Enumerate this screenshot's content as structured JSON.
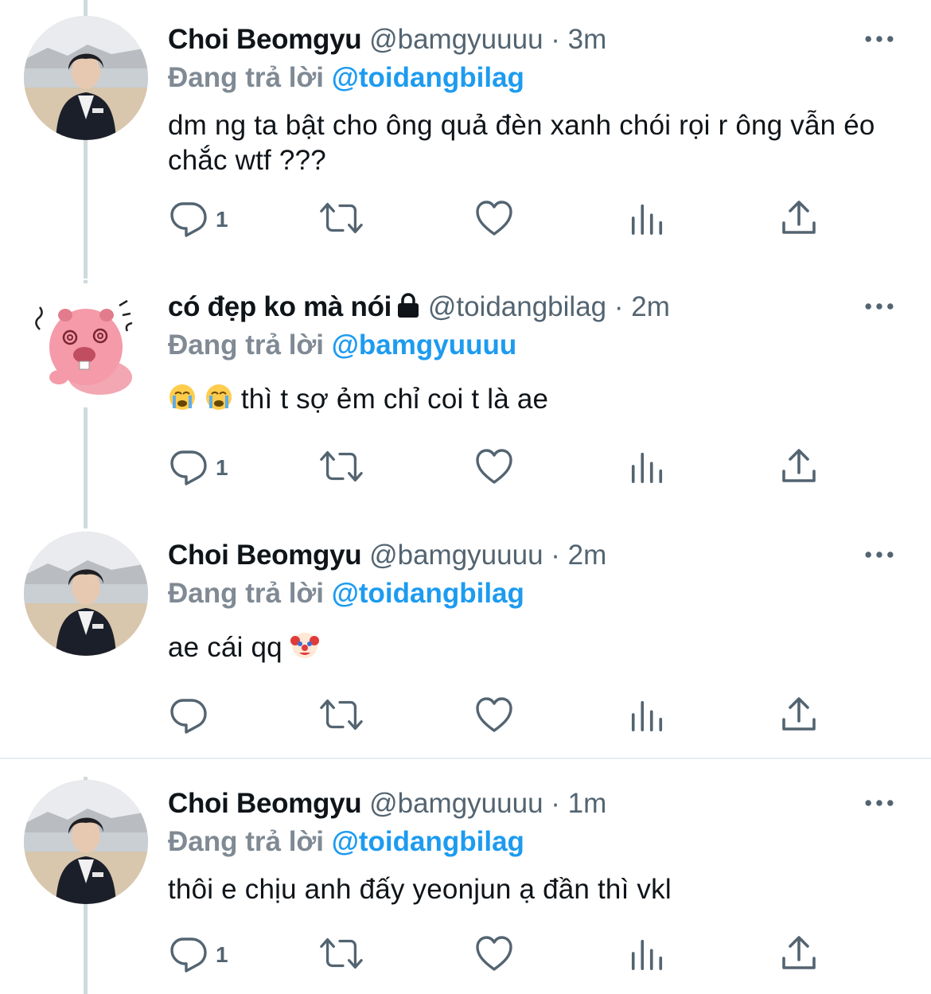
{
  "colors": {
    "accent": "#1d9bf0",
    "muted": "#536471",
    "text": "#0f1419",
    "thread": "#cfd9de"
  },
  "tweets": [
    {
      "name": "Choi Beomgyu",
      "handle": "@bamgyuuuu",
      "dot": "·",
      "time": "3m",
      "replying_label": "Đang trả lời",
      "replying_to": "@toidangbilag",
      "text": "dm ng ta bật cho ông quả đèn xanh chói rọi r ông vẫn éo chắc wtf ???",
      "reply_count": "1",
      "avatar_icon": "person-photo"
    },
    {
      "name": "có đẹp ko mà nói",
      "handle": "@toidangbilag",
      "dot": "·",
      "time": "2m",
      "replying_label": "Đang trả lời",
      "replying_to": "@bamgyuuuu",
      "text": "thì t sợ ẻm chỉ coi t là ae",
      "reply_count": "1",
      "avatar_icon": "pink-beaver-sticker",
      "protected_icon": "lock-icon"
    },
    {
      "name": "Choi Beomgyu",
      "handle": "@bamgyuuuu",
      "dot": "·",
      "time": "2m",
      "replying_label": "Đang trả lời",
      "replying_to": "@toidangbilag",
      "text": "ae cái qq",
      "reply_count": "",
      "avatar_icon": "person-photo"
    },
    {
      "name": "Choi Beomgyu",
      "handle": "@bamgyuuuu",
      "dot": "·",
      "time": "1m",
      "replying_label": "Đang trả lời",
      "replying_to": "@toidangbilag",
      "text": "thôi e chịu anh đấy yeonjun ạ đần thì vkl",
      "reply_count": "1",
      "avatar_icon": "person-photo"
    }
  ]
}
